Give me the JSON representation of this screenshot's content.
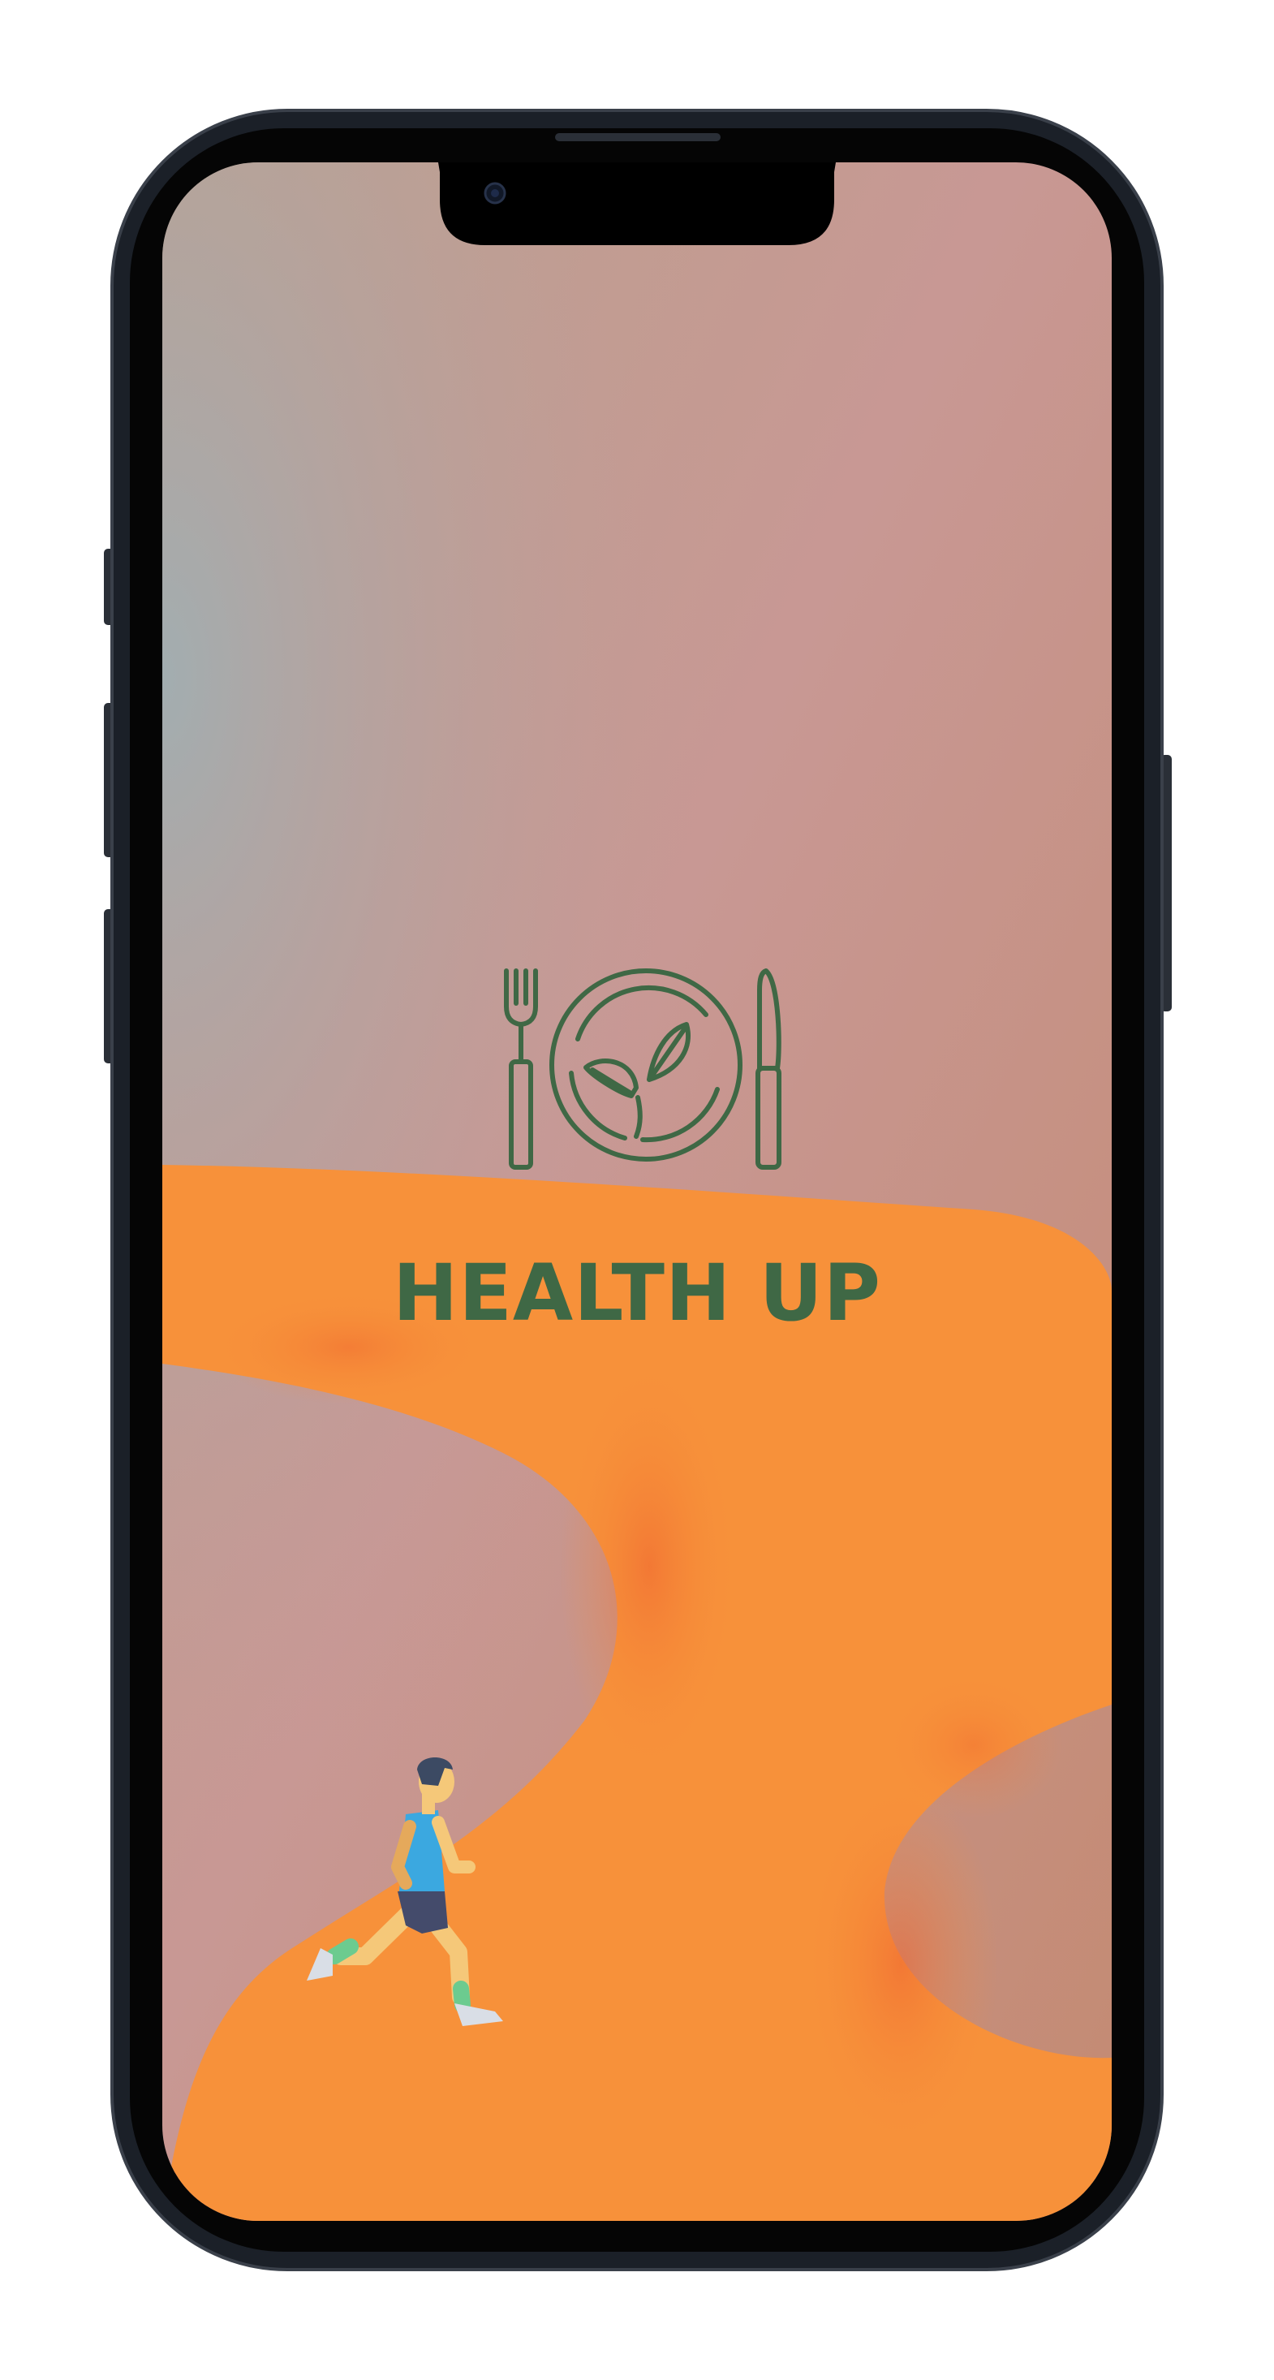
{
  "app": {
    "name": "HEALTH UP"
  },
  "icons": {
    "logo": "plate-fork-knife-leaf-icon",
    "mascot": "runner-illustration"
  },
  "colors": {
    "frame": "#1B2028",
    "bezel": "#050505",
    "accent_green": "#3F6845",
    "path_orange": "#F7913A",
    "background_pink": "#C99896"
  }
}
